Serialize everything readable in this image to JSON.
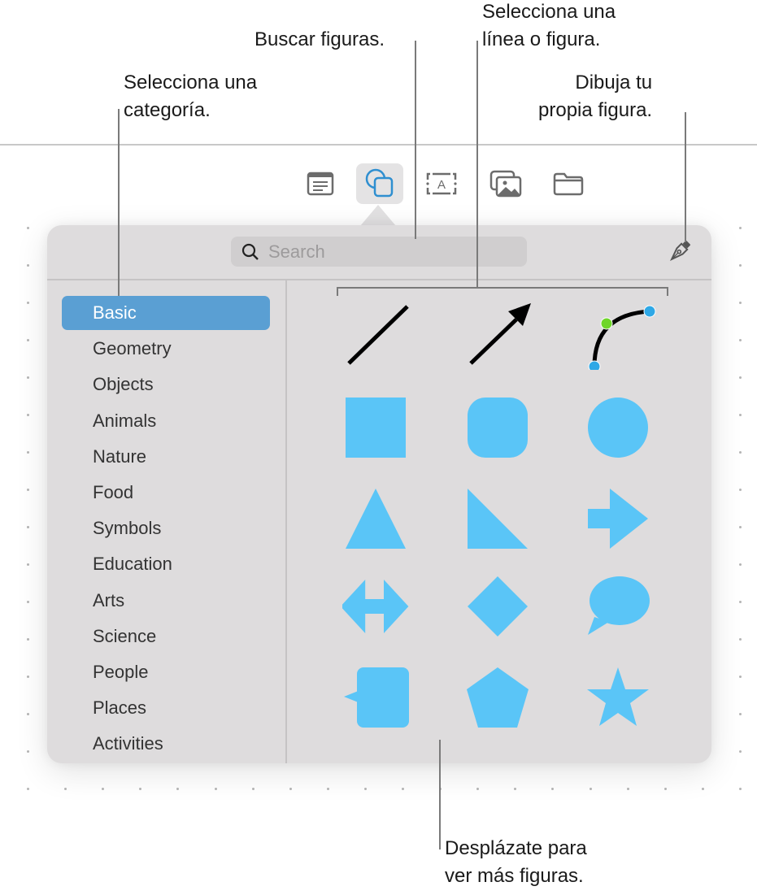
{
  "callouts": {
    "select_category": "Selecciona una\ncategoría.",
    "search_shapes": "Buscar figuras.",
    "select_line_or_shape": "Selecciona una\nlínea o figura.",
    "draw_own_shape": "Dibuja tu\npropia figura.",
    "scroll_more": "Desplázate para\nver más figuras."
  },
  "toolbar": {
    "buttons": [
      {
        "icon": "text-box-icon",
        "active": false
      },
      {
        "icon": "shapes-icon",
        "active": true
      },
      {
        "icon": "text-field-icon",
        "active": false
      },
      {
        "icon": "media-icon",
        "active": false
      },
      {
        "icon": "folder-icon",
        "active": false
      }
    ]
  },
  "popover": {
    "search": {
      "placeholder": "Search",
      "value": ""
    },
    "draw_button": "pen-icon",
    "categories": [
      "Basic",
      "Geometry",
      "Objects",
      "Animals",
      "Nature",
      "Food",
      "Symbols",
      "Education",
      "Arts",
      "Science",
      "People",
      "Places",
      "Activities"
    ],
    "selected_category": "Basic",
    "shapes": [
      "line",
      "arrow-line",
      "curve",
      "square",
      "rounded-square",
      "circle",
      "triangle",
      "right-triangle",
      "arrow-right",
      "double-arrow",
      "diamond",
      "speech-bubble",
      "callout-square",
      "pentagon",
      "star"
    ],
    "colors": {
      "shape_fill": "#5ac5f7",
      "selection": "#5a9fd3",
      "curve_endpoint": "#2fa8e6",
      "curve_control": "#6fd629"
    }
  }
}
